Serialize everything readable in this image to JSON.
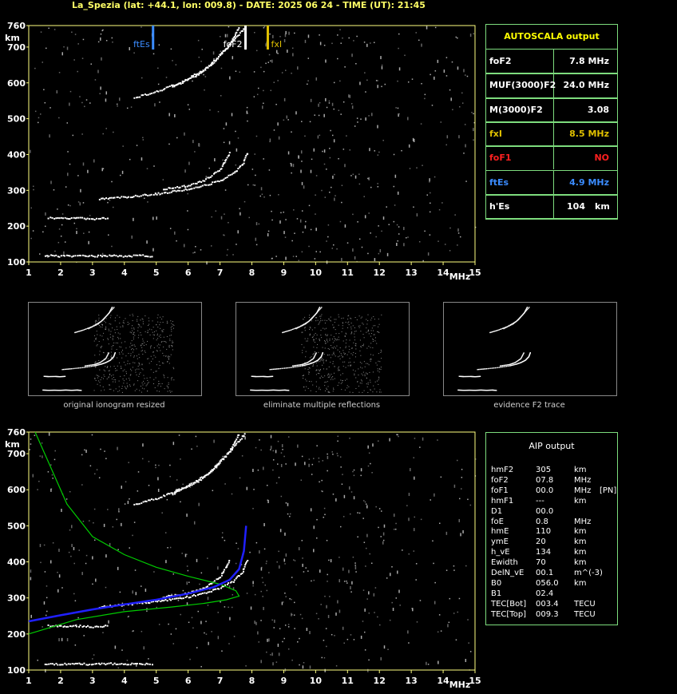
{
  "header": {
    "title": "La_Spezia (lat: +44.1, lon: 009.8) - DATE: 2025 06 24 - TIME (UT): 21:45"
  },
  "colors": {
    "axis": "#ffff80",
    "panel_border": "#7ddc7d",
    "ftEs": "#3b8cff",
    "fxI": "#e0c000",
    "foF1": "#ff2020",
    "trace": "#ffffff",
    "aip_profile_green": "#00cc00",
    "aip_profile_blue": "#2020ff"
  },
  "autoscala": {
    "title": "AUTOSCALA output",
    "rows": [
      {
        "label": "foF2",
        "value": "7.8 MHz",
        "color": "#ffffff"
      },
      {
        "label": "MUF(3000)F2",
        "value": "24.0 MHz",
        "color": "#ffffff"
      },
      {
        "label": "M(3000)F2",
        "value": "3.08",
        "color": "#ffffff"
      },
      {
        "label": "fxI",
        "value": "8.5 MHz",
        "color": "#e0c000"
      },
      {
        "label": "foF1",
        "value": "NO",
        "color": "#ff2020"
      },
      {
        "label": "ftEs",
        "value": "4.9 MHz",
        "color": "#3b8cff"
      },
      {
        "label": "h'Es",
        "value": "104",
        "unit": "km",
        "color": "#ffffff"
      }
    ]
  },
  "thumbnails": {
    "captions": [
      "original ionogram resized",
      "eliminate multiple reflections",
      "evidence F2 trace"
    ]
  },
  "aip": {
    "title": "AIP output",
    "rows": [
      {
        "name": "hmF2",
        "value": "305",
        "unit": "km",
        "extra": ""
      },
      {
        "name": "foF2",
        "value": "07.8",
        "unit": "MHz",
        "extra": ""
      },
      {
        "name": "foF1",
        "value": "00.0",
        "unit": "MHz",
        "extra": "[PN]"
      },
      {
        "name": "hmF1",
        "value": "---",
        "unit": "km",
        "extra": ""
      },
      {
        "name": "D1",
        "value": "00.0",
        "unit": "",
        "extra": ""
      },
      {
        "name": "foE",
        "value": "0.8",
        "unit": "MHz",
        "extra": ""
      },
      {
        "name": "hmE",
        "value": "110",
        "unit": "km",
        "extra": ""
      },
      {
        "name": "ymE",
        "value": "20",
        "unit": "km",
        "extra": ""
      },
      {
        "name": "h_vE",
        "value": "134",
        "unit": "km",
        "extra": ""
      },
      {
        "name": "Ewidth",
        "value": "70",
        "unit": "km",
        "extra": ""
      },
      {
        "name": "DelN_vE",
        "value": "00.1",
        "unit": "m^(-3)",
        "extra": ""
      },
      {
        "name": "B0",
        "value": "056.0",
        "unit": "km",
        "extra": ""
      },
      {
        "name": "B1",
        "value": "02.4",
        "unit": "",
        "extra": ""
      },
      {
        "name": "TEC[Bot]",
        "value": "003.4",
        "unit": "TECU",
        "extra": ""
      },
      {
        "name": "TEC[Top]",
        "value": "009.3",
        "unit": "TECU",
        "extra": ""
      }
    ]
  },
  "chart_data": [
    {
      "type": "scatter",
      "name": "ionogram-autoscala",
      "xlabel": "MHz",
      "ylabel": "km",
      "xlim": [
        1,
        15
      ],
      "ylim": [
        100,
        760
      ],
      "x_ticks": [
        "1",
        "2",
        "3",
        "4",
        "5",
        "6",
        "7",
        "8",
        "9",
        "10",
        "11",
        "12",
        "13",
        "14",
        "15"
      ],
      "y_ticks": [
        "100",
        "200",
        "300",
        "400",
        "500",
        "600",
        "700",
        "760"
      ],
      "markers": [
        {
          "label": "ftEs",
          "x": 4.9,
          "color": "#3b8cff"
        },
        {
          "label": "foF2",
          "x": 7.8,
          "color": "#ffffff"
        },
        {
          "label": "fxI",
          "x": 8.5,
          "color": "#e0c000"
        }
      ],
      "traces": [
        {
          "name": "Es",
          "points": [
            [
              1.5,
              120
            ],
            [
              2.0,
              118
            ],
            [
              2.5,
              119
            ],
            [
              3.0,
              118
            ],
            [
              3.5,
              120
            ],
            [
              4.0,
              118
            ],
            [
              4.5,
              120
            ],
            [
              4.9,
              117
            ]
          ]
        },
        {
          "name": "Es-2",
          "points": [
            [
              1.6,
              225
            ],
            [
              2.0,
              223
            ],
            [
              2.6,
              224
            ],
            [
              3.0,
              222
            ],
            [
              3.5,
              225
            ]
          ]
        },
        {
          "name": "F2-o",
          "points": [
            [
              3.2,
              277
            ],
            [
              4.0,
              283
            ],
            [
              5.0,
              292
            ],
            [
              6.0,
              305
            ],
            [
              6.6,
              318
            ],
            [
              7.0,
              330
            ],
            [
              7.4,
              348
            ],
            [
              7.7,
              375
            ],
            [
              7.85,
              410
            ]
          ]
        },
        {
          "name": "F2-x",
          "points": [
            [
              5.2,
              305
            ],
            [
              6.0,
              315
            ],
            [
              6.5,
              330
            ],
            [
              7.0,
              360
            ],
            [
              7.3,
              410
            ]
          ]
        },
        {
          "name": "F2-2hop-o",
          "points": [
            [
              4.3,
              560
            ],
            [
              5.0,
              578
            ],
            [
              5.8,
              605
            ],
            [
              6.6,
              645
            ],
            [
              7.2,
              700
            ],
            [
              7.8,
              760
            ]
          ]
        },
        {
          "name": "F2-2hop-x",
          "points": [
            [
              5.5,
              590
            ],
            [
              6.3,
              625
            ],
            [
              6.8,
              660
            ],
            [
              7.3,
              710
            ],
            [
              7.6,
              760
            ]
          ]
        }
      ]
    },
    {
      "type": "line",
      "name": "ionogram-aip",
      "xlabel": "MHz",
      "ylabel": "km",
      "xlim": [
        1,
        15
      ],
      "ylim": [
        100,
        760
      ],
      "x_ticks": [
        "1",
        "2",
        "3",
        "4",
        "5",
        "6",
        "7",
        "8",
        "9",
        "10",
        "11",
        "12",
        "13",
        "14",
        "15"
      ],
      "y_ticks": [
        "100",
        "200",
        "300",
        "400",
        "500",
        "600",
        "700",
        "760"
      ],
      "series": [
        {
          "points": [
            [
              1.0,
              200
            ],
            [
              2.5,
              240
            ],
            [
              4.0,
              262
            ],
            [
              5.5,
              275
            ],
            [
              6.5,
              285
            ],
            [
              7.2,
              295
            ],
            [
              7.6,
              305
            ],
            [
              7.5,
              320
            ],
            [
              7.0,
              338
            ],
            [
              6.0,
              360
            ],
            [
              5.0,
              385
            ],
            [
              4.0,
              420
            ],
            [
              3.0,
              470
            ],
            [
              2.2,
              560
            ],
            [
              1.6,
              680
            ],
            [
              1.2,
              760
            ]
          ],
          "color": "#00cc00"
        },
        {
          "points": [
            [
              1.0,
              235
            ],
            [
              2.0,
              252
            ],
            [
              3.0,
              268
            ],
            [
              4.0,
              282
            ],
            [
              5.0,
              295
            ],
            [
              6.0,
              312
            ],
            [
              6.8,
              330
            ],
            [
              7.3,
              350
            ],
            [
              7.6,
              380
            ],
            [
              7.75,
              430
            ],
            [
              7.82,
              500
            ]
          ],
          "color": "#2020ff"
        }
      ],
      "traces": [
        {
          "name": "Es",
          "points": [
            [
              1.5,
              120
            ],
            [
              2.0,
              118
            ],
            [
              2.5,
              119
            ],
            [
              3.0,
              118
            ],
            [
              3.5,
              120
            ],
            [
              4.0,
              118
            ],
            [
              4.5,
              120
            ],
            [
              4.9,
              117
            ]
          ]
        },
        {
          "name": "Es-2",
          "points": [
            [
              1.6,
              225
            ],
            [
              2.0,
              223
            ],
            [
              2.6,
              224
            ],
            [
              3.0,
              222
            ],
            [
              3.5,
              225
            ]
          ]
        },
        {
          "name": "F2-o",
          "points": [
            [
              3.2,
              277
            ],
            [
              4.0,
              283
            ],
            [
              5.0,
              292
            ],
            [
              6.0,
              305
            ],
            [
              6.6,
              318
            ],
            [
              7.0,
              330
            ],
            [
              7.4,
              348
            ],
            [
              7.7,
              375
            ],
            [
              7.85,
              410
            ]
          ]
        },
        {
          "name": "F2-x",
          "points": [
            [
              5.2,
              305
            ],
            [
              6.0,
              315
            ],
            [
              6.5,
              330
            ],
            [
              7.0,
              360
            ],
            [
              7.3,
              410
            ]
          ]
        },
        {
          "name": "F2-2hop-o",
          "points": [
            [
              4.3,
              560
            ],
            [
              5.0,
              578
            ],
            [
              5.8,
              605
            ],
            [
              6.6,
              645
            ],
            [
              7.2,
              700
            ],
            [
              7.8,
              760
            ]
          ]
        },
        {
          "name": "F2-2hop-x",
          "points": [
            [
              5.5,
              590
            ],
            [
              6.3,
              625
            ],
            [
              6.8,
              660
            ],
            [
              7.3,
              710
            ],
            [
              7.6,
              760
            ]
          ]
        }
      ]
    }
  ]
}
